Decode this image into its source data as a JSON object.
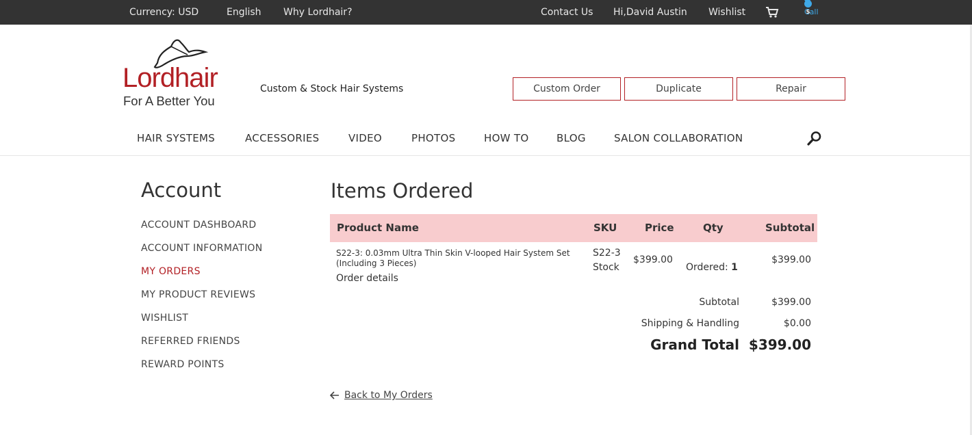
{
  "topbar": {
    "currency": "Currency:  USD",
    "language": "English",
    "why": "Why Lordhair?",
    "contact": "Contact Us",
    "greeting": "Hi,David Austin",
    "wishlist": "Wishlist",
    "call": "Call",
    "cart_icon": "cart-icon",
    "skype_icon": "skype-icon"
  },
  "header": {
    "logo_word": "Lordhair",
    "logo_tag": "For A Better You",
    "tagline": "Custom & Stock Hair Systems",
    "buttons": [
      "Custom Order",
      "Duplicate",
      "Repair"
    ],
    "brand_color": "#b22025"
  },
  "nav": {
    "items": [
      "HAIR SYSTEMS",
      "ACCESSORIES",
      "VIDEO",
      "PHOTOS",
      "HOW TO",
      "BLOG",
      "SALON COLLABORATION"
    ],
    "search_icon": "search-icon"
  },
  "sidebar": {
    "title": "Account",
    "items": [
      "ACCOUNT DASHBOARD",
      "ACCOUNT INFORMATION",
      "MY ORDERS",
      "MY PRODUCT REVIEWS",
      "WISHLIST",
      "REFERRED FRIENDS",
      "REWARD POINTS"
    ],
    "active": "MY ORDERS"
  },
  "order": {
    "title": "Items Ordered",
    "columns": [
      "Product Name",
      "SKU",
      "Price",
      "Qty",
      "Subtotal"
    ],
    "header_color": "#f8ccce",
    "rows": [
      {
        "product_name": "S22-3: 0.03mm Ultra Thin Skin V-looped Hair System Set (Including 3 Pieces)",
        "details_link": "Order details",
        "sku": "S22-3 Stock",
        "price": "$399.00",
        "qty_label": "Ordered:",
        "qty_value": "1",
        "subtotal": "$399.00"
      }
    ],
    "totals": {
      "subtotal_label": "Subtotal",
      "subtotal_value": "$399.00",
      "shipping_label": "Shipping & Handling",
      "shipping_value": "$0.00",
      "grand_label": "Grand Total",
      "grand_value": "$399.00"
    },
    "back_link": "Back to My Orders"
  }
}
